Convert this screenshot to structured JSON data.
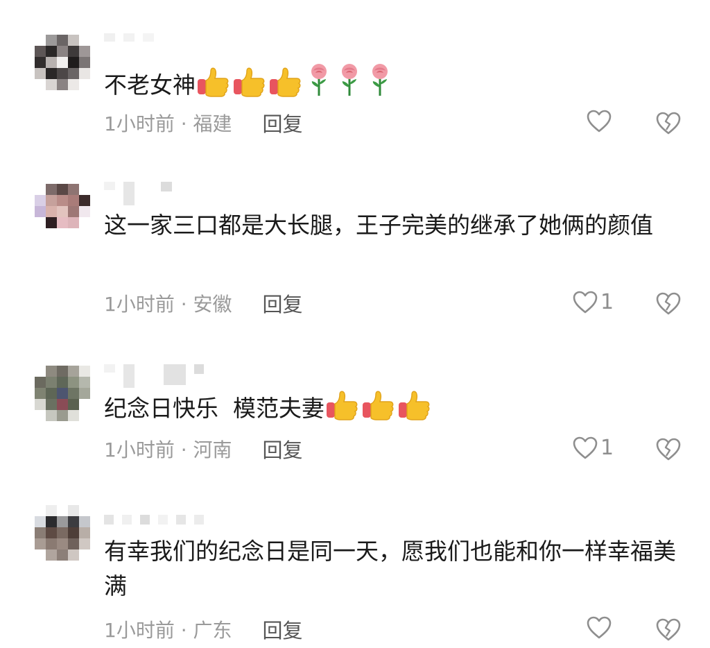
{
  "comments": [
    {
      "text": "不老女神",
      "emojis": [
        "thumbs-up",
        "thumbs-up",
        "thumbs-up",
        "rose",
        "rose",
        "rose"
      ],
      "time_location": "1小时前 · 福建",
      "reply_label": "回复",
      "likes": ""
    },
    {
      "text": "这一家三口都是大长腿，王子完美的继承了她俩的颜值",
      "emojis": [],
      "time_location": "1小时前 · 安徽",
      "reply_label": "回复",
      "likes": "1"
    },
    {
      "text": "纪念日快乐  模范夫妻",
      "emojis": [
        "thumbs-up",
        "thumbs-up",
        "thumbs-up"
      ],
      "time_location": "1小时前 · 河南",
      "reply_label": "回复",
      "likes": "1"
    },
    {
      "text": "有幸我们的纪念日是同一天，愿我们也能和你一样幸福美满",
      "emojis": [],
      "time_location": "1小时前 · 广东",
      "reply_label": "回复",
      "likes": ""
    }
  ],
  "icons": {
    "like": "heart-outline-icon",
    "dislike": "broken-heart-icon"
  },
  "colors": {
    "text": "#1a1a1a",
    "meta": "#9a9a9a",
    "reply": "#555555",
    "icon": "#8e8e8e"
  }
}
